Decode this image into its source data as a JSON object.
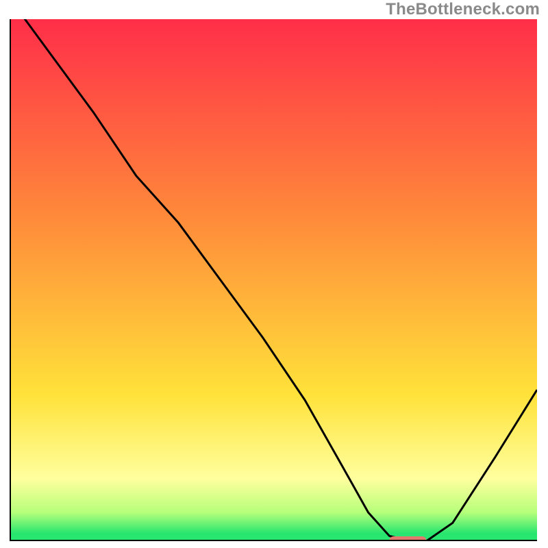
{
  "watermark": "TheBottleneck.com",
  "colors": {
    "gradient_top": "#ff2e49",
    "gradient_mid_orange": "#ff8a3a",
    "gradient_yellow": "#ffe23a",
    "gradient_pale_yellow": "#ffff9e",
    "gradient_light_green": "#b6ff7a",
    "gradient_green": "#28e66f",
    "curve": "#000000",
    "axes": "#000000",
    "marker": "#e2796f",
    "background": "#ffffff"
  },
  "chart_data": {
    "type": "line",
    "title": "",
    "xlabel": "",
    "ylabel": "",
    "xlim": [
      0,
      100
    ],
    "ylim": [
      0,
      100
    ],
    "grid": false,
    "series": [
      {
        "name": "bottleneck-curve",
        "x": [
          0,
          8,
          16,
          24,
          32,
          40,
          48,
          56,
          63,
          68,
          72,
          76,
          79,
          84,
          92,
          100
        ],
        "y": [
          104,
          93,
          82,
          70,
          61,
          50,
          39,
          27,
          14.5,
          5.5,
          1,
          0,
          0,
          3.5,
          16,
          29
        ]
      }
    ],
    "marker": {
      "name": "optimal-zone",
      "x_start": 72,
      "x_end": 79,
      "y": 0
    }
  }
}
